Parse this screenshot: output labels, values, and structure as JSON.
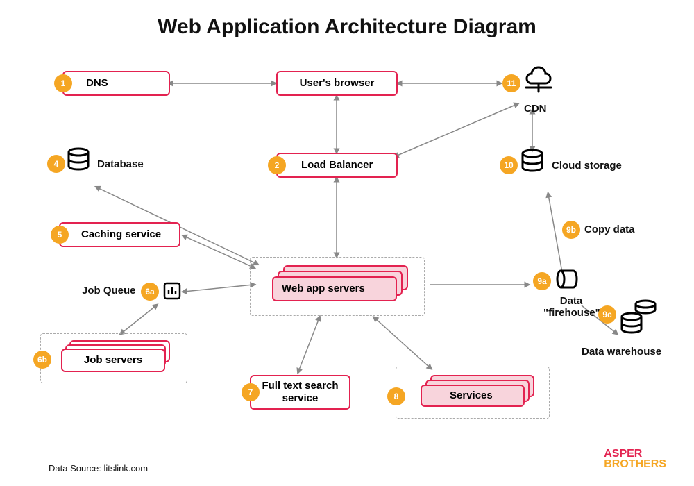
{
  "title": "Web Application Architecture Diagram",
  "source": "Data Source: litslink.com",
  "logo_top": "ASPER",
  "logo_bottom": "BROTHERS",
  "nodes": {
    "dns": {
      "num": "1",
      "label": "DNS"
    },
    "browser": {
      "label": "User's browser"
    },
    "cdn": {
      "num": "11",
      "label": "CDN"
    },
    "lb": {
      "num": "2",
      "label": "Load Balancer"
    },
    "db": {
      "num": "4",
      "label": "Database"
    },
    "cache": {
      "num": "5",
      "label": "Caching service"
    },
    "jobq": {
      "num": "6a",
      "label": "Job Queue"
    },
    "jobs": {
      "num": "6b",
      "label": "Job servers"
    },
    "waps": {
      "label": "Web app servers"
    },
    "fts": {
      "num": "7",
      "label": "Full text search service"
    },
    "svcs": {
      "num": "8",
      "label": "Services"
    },
    "firehose": {
      "num": "9a",
      "label": "Data \"firehouse\""
    },
    "copy": {
      "num": "9b",
      "label": "Copy data"
    },
    "dw": {
      "num": "9c",
      "label": "Data warehouse"
    },
    "cloud": {
      "num": "10",
      "label": "Cloud storage"
    }
  }
}
